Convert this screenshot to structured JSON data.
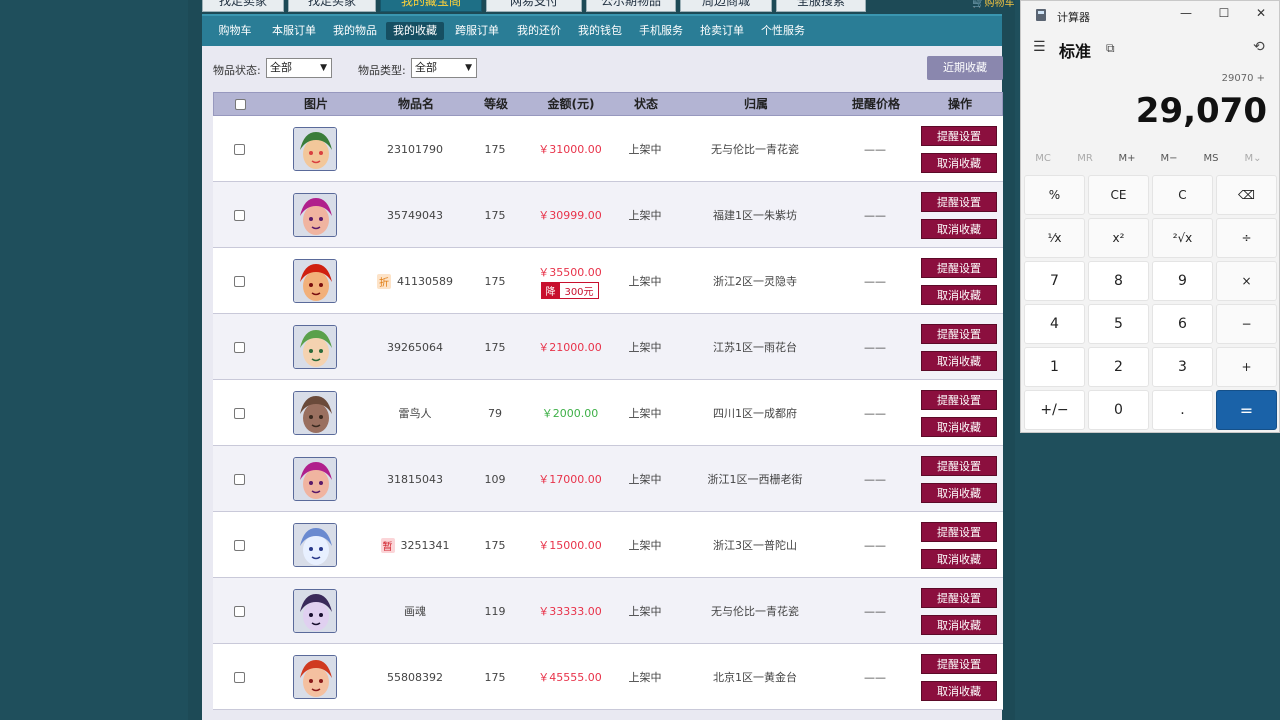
{
  "top_nav": {
    "tabs": [
      {
        "label": "找走卖家",
        "active": false
      },
      {
        "label": "找走买家",
        "active": false
      },
      {
        "label": "我的藏宝阁",
        "active": true
      },
      {
        "label": "网易支付",
        "active": false
      },
      {
        "label": "公示期物品",
        "active": false
      },
      {
        "label": "周边商城",
        "active": false
      },
      {
        "label": "全服搜索",
        "active": false
      }
    ],
    "cart": "购物车"
  },
  "sub_nav": {
    "items": [
      {
        "label": "购物车",
        "active": false
      },
      {
        "label": "本服订单",
        "active": false
      },
      {
        "label": "我的物品",
        "active": false
      },
      {
        "label": "我的收藏",
        "active": true
      },
      {
        "label": "跨服订单",
        "active": false
      },
      {
        "label": "我的还价",
        "active": false
      },
      {
        "label": "我的钱包",
        "active": false
      },
      {
        "label": "手机服务",
        "active": false
      },
      {
        "label": "抢卖订单",
        "active": false
      },
      {
        "label": "个性服务",
        "active": false
      }
    ]
  },
  "filters": {
    "status_label": "物品状态:",
    "status_value": "全部",
    "type_label": "物品类型:",
    "type_value": "全部",
    "recent_button": "近期收藏"
  },
  "table": {
    "headers": [
      "图片",
      "物品名",
      "等级",
      "金额(元)",
      "状态",
      "归属",
      "提醒价格",
      "操作"
    ],
    "buttons": {
      "remind": "提醒设置",
      "cancel": "取消收藏"
    },
    "rows": [
      {
        "name": "23101790",
        "level": "175",
        "price": "￥31000.00",
        "status": "上架中",
        "server": "无与伦比一青花瓷",
        "remind": "——",
        "tag": "",
        "drop": null,
        "green": false
      },
      {
        "name": "35749043",
        "level": "175",
        "price": "￥30999.00",
        "status": "上架中",
        "server": "福建1区一朱紫坊",
        "remind": "——",
        "tag": "",
        "drop": null,
        "green": false
      },
      {
        "name": "41130589",
        "level": "175",
        "price": "￥35500.00",
        "status": "上架中",
        "server": "浙江2区一灵隐寺",
        "remind": "——",
        "tag": "折",
        "drop": {
          "label": "降",
          "amount": "300元"
        },
        "green": false
      },
      {
        "name": "39265064",
        "level": "175",
        "price": "￥21000.00",
        "status": "上架中",
        "server": "江苏1区一雨花台",
        "remind": "——",
        "tag": "",
        "drop": null,
        "green": false
      },
      {
        "name": "雷鸟人",
        "level": "79",
        "price": "￥2000.00",
        "status": "上架中",
        "server": "四川1区一成都府",
        "remind": "——",
        "tag": "",
        "drop": null,
        "green": true
      },
      {
        "name": "31815043",
        "level": "109",
        "price": "￥17000.00",
        "status": "上架中",
        "server": "浙江1区一西栅老街",
        "remind": "——",
        "tag": "",
        "drop": null,
        "green": false
      },
      {
        "name": "3251341",
        "level": "175",
        "price": "￥15000.00",
        "status": "上架中",
        "server": "浙江3区一普陀山",
        "remind": "——",
        "tag": "暂",
        "drop": null,
        "green": false
      },
      {
        "name": "画魂",
        "level": "119",
        "price": "￥33333.00",
        "status": "上架中",
        "server": "无与伦比一青花瓷",
        "remind": "——",
        "tag": "",
        "drop": null,
        "green": false
      },
      {
        "name": "55808392",
        "level": "175",
        "price": "￥45555.00",
        "status": "上架中",
        "server": "北京1区一黄金台",
        "remind": "——",
        "tag": "",
        "drop": null,
        "green": false
      }
    ]
  },
  "calculator": {
    "title": "计算器",
    "mode": "标准",
    "expression": "29070 +",
    "display": "29,070",
    "memory": [
      "MC",
      "MR",
      "M+",
      "M−",
      "MS",
      "M⌄"
    ],
    "keys": [
      "%",
      "CE",
      "C",
      "⌫",
      "¹⁄x",
      "x²",
      "²√x",
      "÷",
      "7",
      "8",
      "9",
      "×",
      "4",
      "5",
      "6",
      "−",
      "1",
      "2",
      "3",
      "+",
      "+/−",
      "0",
      ".",
      "="
    ]
  }
}
